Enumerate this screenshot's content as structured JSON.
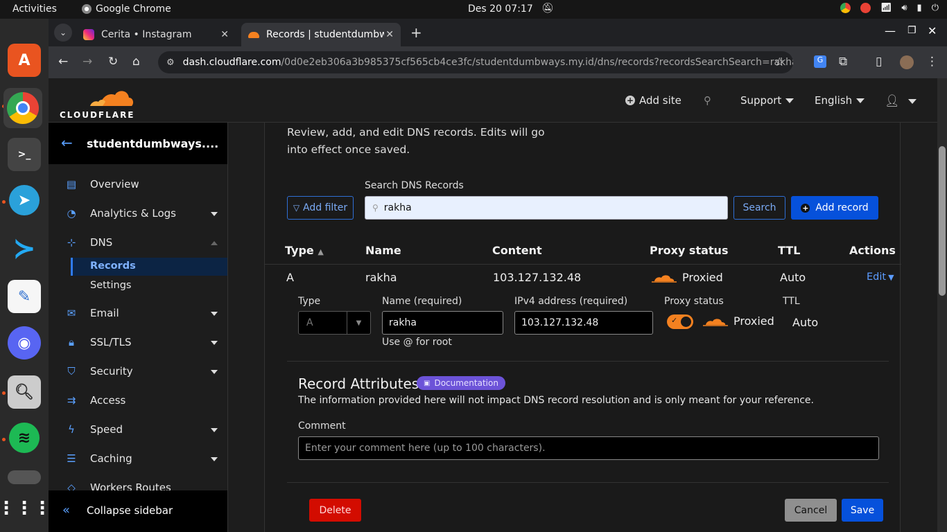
{
  "os": {
    "activities": "Activities",
    "app_name": "Google Chrome",
    "clock": "Des 20  07:17"
  },
  "browser": {
    "tabs": [
      {
        "label": "Cerita • Instagram"
      },
      {
        "label": "Records | studentdumbw"
      }
    ],
    "url_host": "dash.cloudflare.com",
    "url_path": "/0d0e2eb306a3b985375cf565cb4ce3fc/studentdumbways.my.id/dns/records?recordsSearchSearch=rakha"
  },
  "header": {
    "logo_text": "CLOUDFLARE",
    "add_site": "Add site",
    "support": "Support",
    "language": "English"
  },
  "sidebar": {
    "zone_name": "studentdumbways....",
    "items": [
      {
        "label": "Overview"
      },
      {
        "label": "Analytics & Logs"
      },
      {
        "label": "DNS"
      },
      {
        "label": "Records"
      },
      {
        "label": "Settings"
      },
      {
        "label": "Email"
      },
      {
        "label": "SSL/TLS"
      },
      {
        "label": "Security"
      },
      {
        "label": "Access"
      },
      {
        "label": "Speed"
      },
      {
        "label": "Caching"
      },
      {
        "label": "Workers Routes"
      }
    ],
    "collapse": "Collapse sidebar"
  },
  "main": {
    "intro": "Review, add, and edit DNS records. Edits will go into effect once saved.",
    "add_filter": "Add filter",
    "search_label": "Search DNS Records",
    "search_value": "rakha",
    "search_button": "Search",
    "add_record": "Add record",
    "columns": [
      "Type",
      "Name",
      "Content",
      "Proxy status",
      "TTL",
      "Actions"
    ],
    "record": {
      "type": "A",
      "name": "rakha",
      "content": "103.127.132.48",
      "proxy": "Proxied",
      "ttl": "Auto",
      "action": "Edit"
    },
    "edit": {
      "type_label": "Type",
      "type_value": "A",
      "name_label": "Name (required)",
      "name_value": "rakha",
      "name_hint": "Use @ for root",
      "ip_label": "IPv4 address (required)",
      "ip_value": "103.127.132.48",
      "proxy_label": "Proxy status",
      "proxy_value": "Proxied",
      "ttl_label": "TTL",
      "ttl_value": "Auto"
    },
    "attributes": {
      "title": "Record Attributes",
      "doc_badge": "Documentation",
      "description": "The information provided here will not impact DNS record resolution and is only meant for your reference.",
      "comment_label": "Comment",
      "comment_placeholder": "Enter your comment here (up to 100 characters)."
    },
    "buttons": {
      "delete": "Delete",
      "cancel": "Cancel",
      "save": "Save"
    }
  },
  "colors": {
    "accent_orange": "#f48120",
    "primary_blue": "#0651db",
    "delete_red": "#d30c00"
  }
}
